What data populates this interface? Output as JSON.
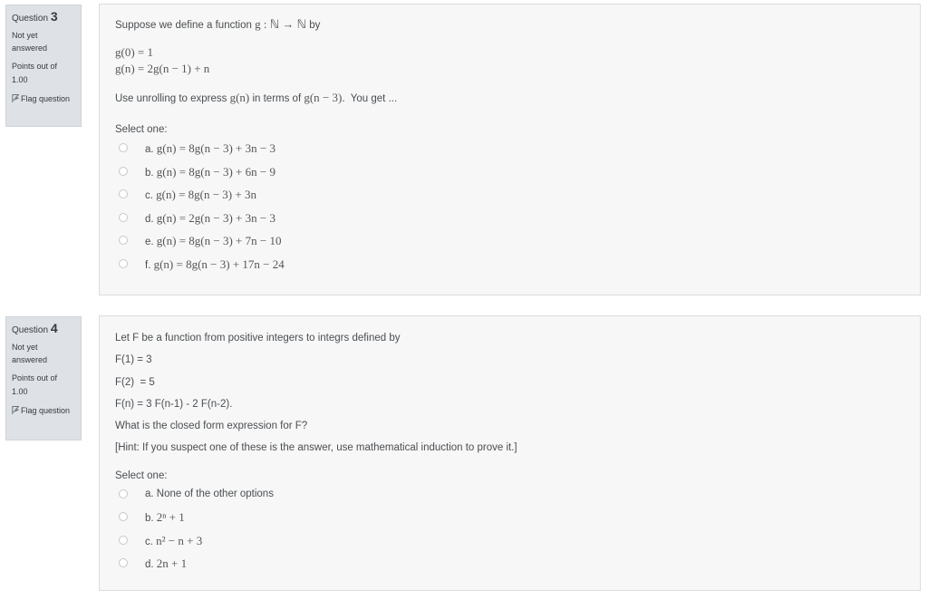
{
  "questions": [
    {
      "label": "Question",
      "number": "3",
      "state": "Not yet answered",
      "grade": "Points out of 1.00",
      "flag_label": "Flag question",
      "intro": "Suppose we define a function",
      "intro_math": "g : ℕ → ℕ",
      "intro_end": "by",
      "def_lines": [
        "g(0) = 1",
        "g(n) = 2g(n − 1) + n"
      ],
      "prompt_a": "Use unrolling to express",
      "prompt_math1": "g(n)",
      "prompt_b": "in terms of",
      "prompt_math2": "g(n − 3).",
      "prompt_c": "You get ...",
      "select_label": "Select one:",
      "options": [
        {
          "letter": "a.",
          "text": "g(n) = 8g(n − 3) + 3n − 3"
        },
        {
          "letter": "b.",
          "text": "g(n) = 8g(n − 3) + 6n − 9"
        },
        {
          "letter": "c.",
          "text": "g(n) = 8g(n − 3) + 3n"
        },
        {
          "letter": "d.",
          "text": "g(n) = 2g(n − 3) + 3n − 3"
        },
        {
          "letter": "e.",
          "text": "g(n) = 8g(n − 3) + 7n − 10"
        },
        {
          "letter": "f.",
          "text": "g(n) = 8g(n − 3) + 17n − 24"
        }
      ]
    },
    {
      "label": "Question",
      "number": "4",
      "state": "Not yet answered",
      "grade": "Points out of 1.00",
      "flag_label": "Flag question",
      "lines": [
        "Let F be a function from positive integers to integrs defined by",
        "F(1) = 3",
        "F(2)  = 5",
        "F(n) = 3 F(n-1) - 2 F(n-2).",
        "What is the closed form expression for F?",
        "[Hint: If you suspect one of these is the answer, use mathematical induction to prove it.]"
      ],
      "select_label": "Select one:",
      "options": [
        {
          "letter": "a.",
          "text": "None of the other options",
          "math": false
        },
        {
          "letter": "b.",
          "text": "2ⁿ + 1",
          "math": true
        },
        {
          "letter": "c.",
          "text": "n² − n + 3",
          "math": true
        },
        {
          "letter": "d.",
          "text": "2n + 1",
          "math": true
        }
      ]
    }
  ]
}
